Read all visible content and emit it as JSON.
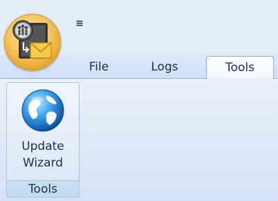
{
  "app": {
    "button_icon": "app-logo-icon",
    "qat_icon": "customize-quick-access-toolbar-icon"
  },
  "tabs": [
    {
      "label": "File",
      "active": false
    },
    {
      "label": "Logs",
      "active": false
    },
    {
      "label": "Tools",
      "active": true
    }
  ],
  "ribbon": {
    "groups": [
      {
        "label": "Tools",
        "buttons": [
          {
            "label_line1": "Update",
            "label_line2": "Wizard",
            "icon": "globe-icon"
          }
        ]
      }
    ]
  },
  "colors": {
    "accent": "#8eaed5",
    "ribbon_bg": "#dce8f6",
    "text": "#1b2f4a",
    "app_button": "#f6c45c"
  }
}
